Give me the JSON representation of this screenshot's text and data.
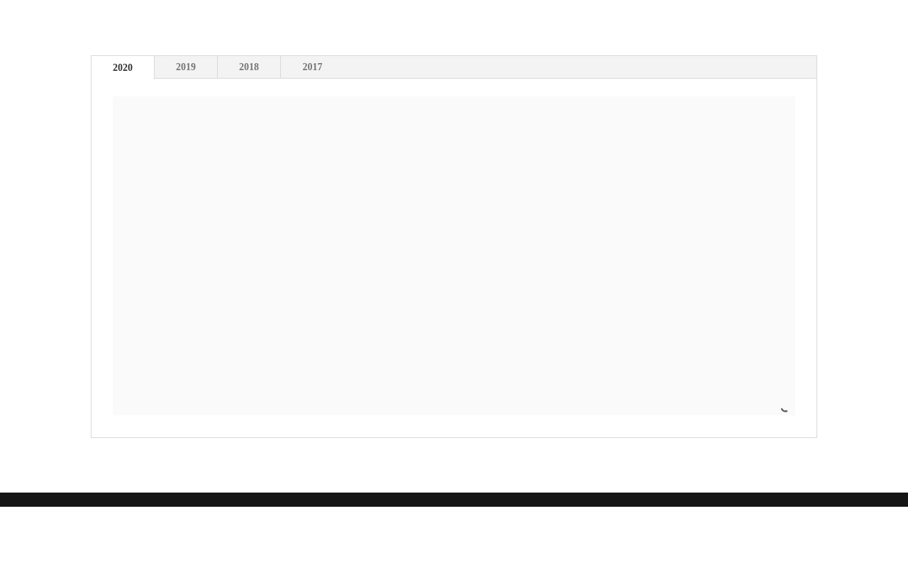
{
  "tabs": [
    {
      "label": "2020",
      "selected": true
    },
    {
      "label": "2019",
      "selected": false
    },
    {
      "label": "2018",
      "selected": false
    },
    {
      "label": "2017",
      "selected": false
    }
  ],
  "panel": {
    "loading": true
  }
}
